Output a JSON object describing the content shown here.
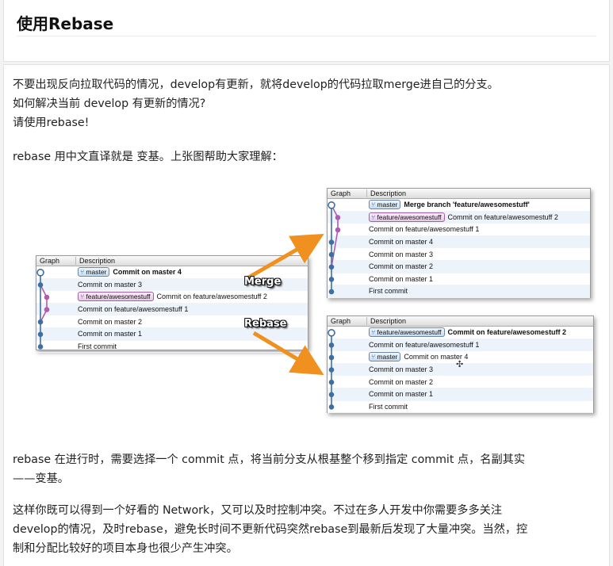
{
  "page": {
    "title": "使用Rebase"
  },
  "intro": {
    "lines": [
      "不要出现反向拉取代码的情况，develop有更新，就将develop的代码拉取merge进自己的分支。",
      "如何解决当前 develop 有更新的情况?",
      "请使用rebase!"
    ]
  },
  "lead_in": "rebase 用中文直译就是 变基。上张图帮助大家理解：",
  "figure": {
    "header": {
      "graph": "Graph",
      "description": "Description"
    },
    "merge_label": "Merge",
    "rebase_label": "Rebase",
    "left": {
      "rows": [
        {
          "tag": "master",
          "tag_kind": "master",
          "text": "Commit on master 4",
          "bold": true
        },
        {
          "text": "Commit on master 3"
        },
        {
          "tag": "feature/awesomestuff",
          "tag_kind": "feature",
          "text": "Commit on feature/awesomestuff 2"
        },
        {
          "text": "Commit on feature/awesomestuff 1"
        },
        {
          "text": "Commit on master 2"
        },
        {
          "text": "Commit on master 1"
        },
        {
          "text": "First commit"
        }
      ]
    },
    "merge": {
      "rows": [
        {
          "tag": "master",
          "tag_kind": "master",
          "text": "Merge branch 'feature/awesomestuff'",
          "bold": true
        },
        {
          "tag": "feature/awesomestuff",
          "tag_kind": "feature",
          "text": "Commit on feature/awesomestuff 2"
        },
        {
          "text": "Commit on feature/awesomestuff 1"
        },
        {
          "text": "Commit on master 4"
        },
        {
          "text": "Commit on master 3"
        },
        {
          "text": "Commit on master 2"
        },
        {
          "text": "Commit on master 1"
        },
        {
          "text": "First commit"
        }
      ]
    },
    "rebase": {
      "rows": [
        {
          "tag": "feature/awesomestuff",
          "tag_kind": "master",
          "text": "Commit on feature/awesomestuff 2",
          "bold": true
        },
        {
          "text": "Commit on feature/awesomestuff 1"
        },
        {
          "tag": "master",
          "tag_kind": "master",
          "text": "Commit on master 4"
        },
        {
          "text": "Commit on master 3"
        },
        {
          "text": "Commit on master 2"
        },
        {
          "text": "Commit on master 1"
        },
        {
          "text": "First commit"
        }
      ]
    }
  },
  "explain": {
    "lines": [
      "rebase 在进行时，需要选择一个 commit 点，将当前分支从根基整个移到指定 commit 点，名副其实",
      "——变基。"
    ]
  },
  "benefits": {
    "lines": [
      "这样你既可以得到一个好看的 Network，又可以及时控制冲突。不过在多人开发中你需要多多关注",
      "develop的情况，及时rebase，避免长时间不更新代码突然rebase到最新后发现了大量冲突。当然，控",
      "制和分配比较好的项目本身也很少产生冲突。"
    ]
  },
  "colors": {
    "master_line": "#3f6fa0",
    "feature_line": "#b05cb0",
    "arrow": "#f0901e"
  }
}
